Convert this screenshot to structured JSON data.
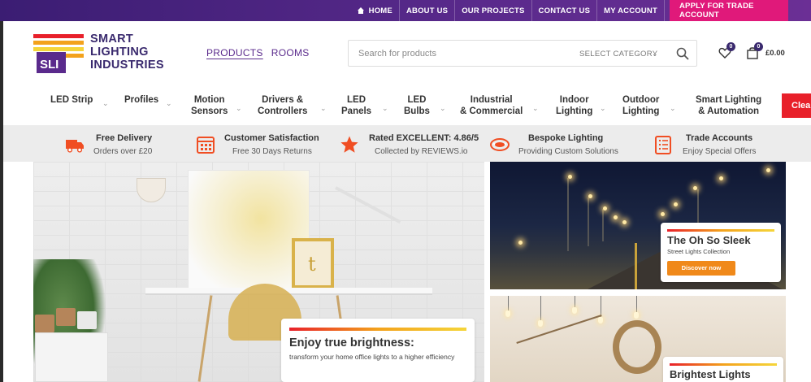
{
  "topbar": {
    "links": [
      {
        "label": "HOME",
        "icon": "home-icon"
      },
      {
        "label": "ABOUT US"
      },
      {
        "label": "OUR PROJECTS"
      },
      {
        "label": "CONTACT US"
      },
      {
        "label": "MY ACCOUNT"
      }
    ],
    "trade_label": "APPLY FOR TRADE ACCOUNT",
    "trade_color": "#e0197a"
  },
  "logo": {
    "mark": "SLI",
    "line1": "SMART",
    "line2": "LIGHTING",
    "line3": "INDUSTRIES"
  },
  "catnav": {
    "products": "PRODUCTS",
    "rooms": "ROOMS"
  },
  "search": {
    "placeholder": "Search for products",
    "category": "SELECT CATEGORY"
  },
  "header_icons": {
    "wishlist_count": "0",
    "cart_count": "0",
    "cart_total": "£0.00"
  },
  "menu": [
    {
      "line1": "LED Strip",
      "line2": ""
    },
    {
      "line1": "Profiles",
      "line2": ""
    },
    {
      "line1": "Motion",
      "line2": "Sensors"
    },
    {
      "line1": "Drivers &",
      "line2": "Controllers"
    },
    {
      "line1": "LED",
      "line2": "Panels"
    },
    {
      "line1": "LED",
      "line2": "Bulbs"
    },
    {
      "line1": "Industrial",
      "line2": "& Commercial"
    },
    {
      "line1": "Indoor",
      "line2": "Lighting"
    },
    {
      "line1": "Outdoor",
      "line2": "Lighting"
    },
    {
      "line1": "Smart Lighting",
      "line2": "& Automation"
    }
  ],
  "menu_clear": "Clea",
  "features": [
    {
      "title": "Free Delivery",
      "sub": "Orders over £20",
      "icon": "truck-icon"
    },
    {
      "title": "Customer Satisfaction",
      "sub": "Free 30 Days Returns",
      "icon": "calendar-icon"
    },
    {
      "title": "Rated EXCELLENT: 4.86/5",
      "sub": "Collected by REVIEWS.io",
      "icon": "star-icon"
    },
    {
      "title": "Bespoke Lighting",
      "sub": "Providing Custom Solutions",
      "icon": "lightstrip-icon"
    },
    {
      "title": "Trade Accounts",
      "sub": "Enjoy Special Offers",
      "icon": "clipboard-icon"
    }
  ],
  "hero_main": {
    "title": "Enjoy true brightness:",
    "subtitle": "transform your home office lights to a higher efficiency"
  },
  "hero_street": {
    "title": "The Oh So Sleek",
    "subtitle": "Street Lights Collection",
    "button": "Discover now"
  },
  "hero_bright": {
    "title": "Brightest Lights"
  }
}
